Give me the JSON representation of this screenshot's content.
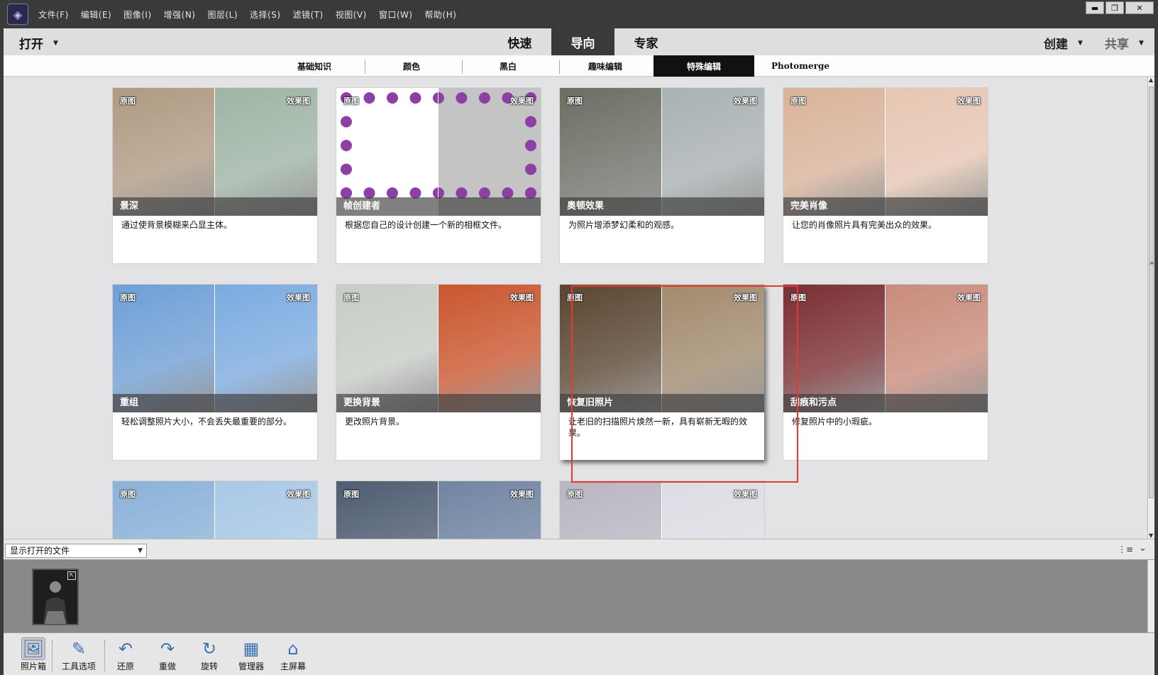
{
  "menu": [
    "文件(F)",
    "编辑(E)",
    "图像(I)",
    "增强(N)",
    "图层(L)",
    "选择(S)",
    "滤镜(T)",
    "视图(V)",
    "窗口(W)",
    "帮助(H)"
  ],
  "window_controls": {
    "minimize": "▬",
    "maximize": "❐",
    "close": "✕"
  },
  "modebar": {
    "open_label": "打开",
    "modes": [
      "快速",
      "导向",
      "专家"
    ],
    "active_mode": "导向",
    "create_label": "创建",
    "share_label": "共享"
  },
  "subtabs": [
    "基础知识",
    "颜色",
    "黑白",
    "趣味编辑",
    "特殊编辑",
    "Photomerge"
  ],
  "active_subtab": "特殊编辑",
  "tag_before": "原图",
  "tag_after": "效果图",
  "cards": [
    {
      "title": "景深",
      "desc": "通过使背景模糊来凸显主体。",
      "left_color": "#b09a82",
      "right_color": "#9fb4a4"
    },
    {
      "title": "帧创建者",
      "desc": "根据您自己的设计创建一个新的相框文件。",
      "left_color": "#ffffff",
      "right_color": "#c8c8c8"
    },
    {
      "title": "奥顿效果",
      "desc": "为照片增添梦幻柔和的观感。",
      "left_color": "#6a6e63",
      "right_color": "#a9b1b3"
    },
    {
      "title": "完美肖像",
      "desc": "让您的肖像照片具有完美出众的效果。",
      "left_color": "#d9b39a",
      "right_color": "#e6c6b2"
    },
    {
      "title": "重组",
      "desc": "轻松调整照片大小，不会丢失最重要的部分。",
      "left_color": "#6f9fd6",
      "right_color": "#7cabe0"
    },
    {
      "title": "更换背景",
      "desc": "更改照片背景。",
      "left_color": "#c7ccc6",
      "right_color": "#c9572f"
    },
    {
      "title": "恢复旧照片",
      "desc": "让老旧的扫描照片焕然一新，具有崭新无暇的效果。",
      "left_color": "#5a4530",
      "right_color": "#a28a6e"
    },
    {
      "title": "刮痕和污点",
      "desc": "修复照片中的小瑕疵。",
      "left_color": "#7a2f33",
      "right_color": "#c98c7c"
    },
    {
      "title": "",
      "desc": "",
      "left_color": "#8bb2d8",
      "right_color": "#a9c8e6"
    },
    {
      "title": "",
      "desc": "",
      "left_color": "#4f5c72",
      "right_color": "#7184a2"
    },
    {
      "title": "",
      "desc": "",
      "left_color": "#b9b6c2",
      "right_color": "#dcdce4"
    }
  ],
  "bin": {
    "select_value": "显示打开的文件"
  },
  "toolbar": [
    {
      "label": "照片箱",
      "icon": "photo-bin-icon",
      "glyph": "🖼"
    },
    {
      "label": "工具选项",
      "icon": "tool-options-icon",
      "glyph": "✎"
    },
    {
      "label": "还原",
      "icon": "undo-icon",
      "glyph": "↶"
    },
    {
      "label": "重做",
      "icon": "redo-icon",
      "glyph": "↷"
    },
    {
      "label": "旋转",
      "icon": "rotate-icon",
      "glyph": "↻"
    },
    {
      "label": "管理器",
      "icon": "organizer-icon",
      "glyph": "▦"
    },
    {
      "label": "主屏幕",
      "icon": "home-icon",
      "glyph": "⌂"
    }
  ]
}
